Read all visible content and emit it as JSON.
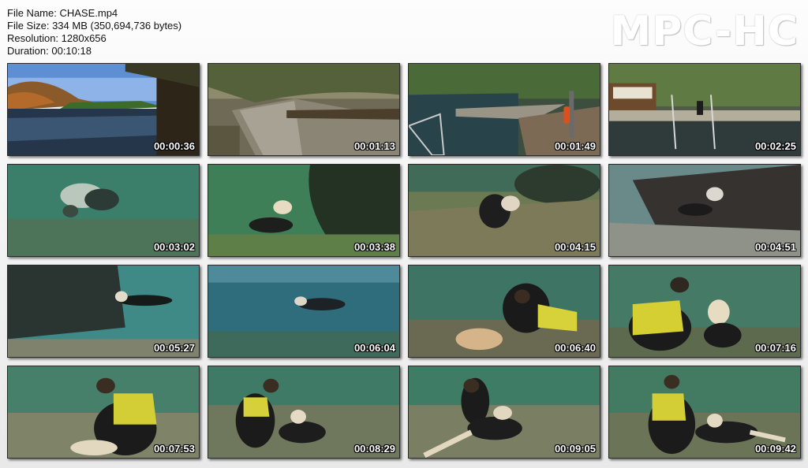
{
  "file_info": {
    "name_line": "File Name: CHASE.mp4",
    "size_line": "File Size: 334 MB (350,694,736 bytes)",
    "resolution_line": "Resolution: 1280x656",
    "duration_line": "Duration: 00:10:18"
  },
  "logo": "MPC-HC",
  "thumbnails": [
    {
      "timestamp": "00:00:36"
    },
    {
      "timestamp": "00:01:13"
    },
    {
      "timestamp": "00:01:49"
    },
    {
      "timestamp": "00:02:25"
    },
    {
      "timestamp": "00:03:02"
    },
    {
      "timestamp": "00:03:38"
    },
    {
      "timestamp": "00:04:15"
    },
    {
      "timestamp": "00:04:51"
    },
    {
      "timestamp": "00:05:27"
    },
    {
      "timestamp": "00:06:04"
    },
    {
      "timestamp": "00:06:40"
    },
    {
      "timestamp": "00:07:16"
    },
    {
      "timestamp": "00:07:53"
    },
    {
      "timestamp": "00:08:29"
    },
    {
      "timestamp": "00:09:05"
    },
    {
      "timestamp": "00:09:42"
    }
  ]
}
